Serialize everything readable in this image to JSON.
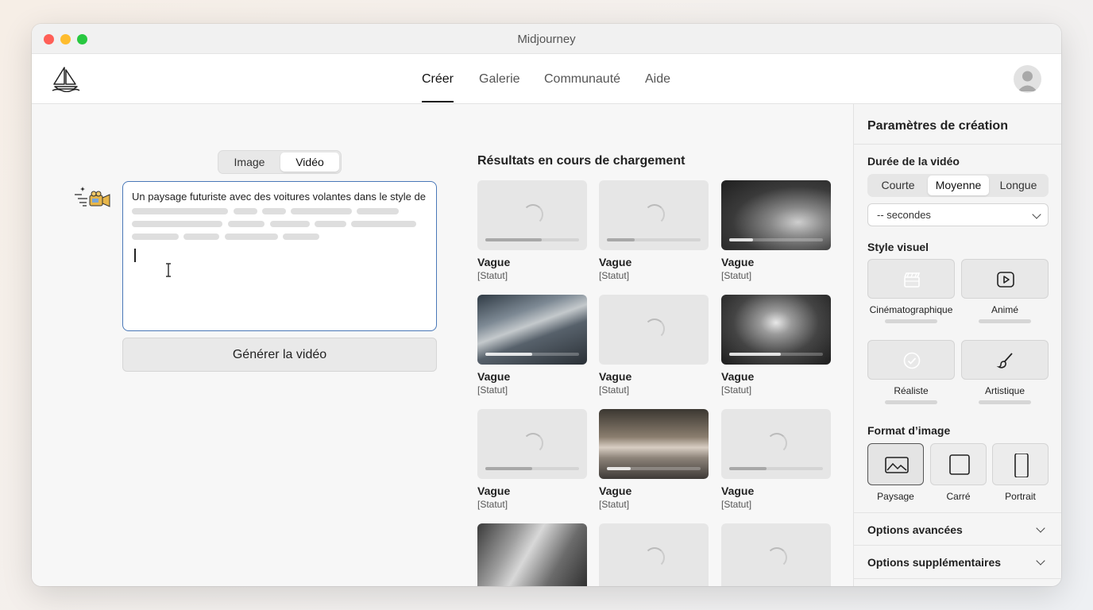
{
  "window": {
    "title": "Midjourney"
  },
  "nav": {
    "tabs": [
      {
        "label": "Créer",
        "active": true
      },
      {
        "label": "Galerie",
        "active": false
      },
      {
        "label": "Communauté",
        "active": false
      },
      {
        "label": "Aide",
        "active": false
      }
    ],
    "logo_icon": "sailboat-logo-icon",
    "avatar_icon": "user-avatar-icon"
  },
  "composer": {
    "mode_toggle": [
      {
        "label": "Image",
        "active": false
      },
      {
        "label": "Vidéo",
        "active": true
      }
    ],
    "prompt_icon": "video-camera-sparkle-icon",
    "prompt_text": "Un paysage futuriste avec des voitures volantes dans le style de",
    "generate_label": "Générer la vidéo"
  },
  "results": {
    "title": "Résultats en cours de chargement",
    "items": [
      {
        "name": "Vague",
        "status": "[Statut]",
        "state": "loading",
        "progress": 0.6
      },
      {
        "name": "Vague",
        "status": "[Statut]",
        "state": "loading",
        "progress": 0.3
      },
      {
        "name": "Vague",
        "status": "[Statut]",
        "state": "preview",
        "progress": 0.25
      },
      {
        "name": "Vague",
        "status": "[Statut]",
        "state": "preview",
        "progress": 0.5
      },
      {
        "name": "Vague",
        "status": "[Statut]",
        "state": "loading",
        "progress": 0
      },
      {
        "name": "Vague",
        "status": "[Statut]",
        "state": "preview",
        "progress": 0.55
      },
      {
        "name": "Vague",
        "status": "[Statut]",
        "state": "loading",
        "progress": 0.5
      },
      {
        "name": "Vague",
        "status": "[Statut]",
        "state": "preview",
        "progress": 0.25
      },
      {
        "name": "Vague",
        "status": "[Statut]",
        "state": "loading",
        "progress": 0.4
      },
      {
        "name": "",
        "status": "",
        "state": "preview",
        "progress": 0
      },
      {
        "name": "",
        "status": "",
        "state": "loading",
        "progress": 0
      },
      {
        "name": "",
        "status": "",
        "state": "loading",
        "progress": 0
      }
    ]
  },
  "settings": {
    "title": "Paramètres de création",
    "duration": {
      "label": "Durée de la vidéo",
      "options": [
        {
          "label": "Courte",
          "active": false
        },
        {
          "label": "Moyenne",
          "active": true
        },
        {
          "label": "Longue",
          "active": false
        }
      ],
      "seconds_select": "-- secondes"
    },
    "style": {
      "label": "Style visuel",
      "options": [
        {
          "label": "Cinématographique",
          "icon": "clapperboard-icon"
        },
        {
          "label": "Animé",
          "icon": "play-icon"
        },
        {
          "label": "Réaliste",
          "icon": "checkmark-circle-icon"
        },
        {
          "label": "Artistique",
          "icon": "paintbrush-icon"
        }
      ]
    },
    "format": {
      "label": "Format d’image",
      "options": [
        {
          "label": "Paysage",
          "icon": "landscape-image-icon",
          "selected": true
        },
        {
          "label": "Carré",
          "icon": "square-icon",
          "selected": false
        },
        {
          "label": "Portrait",
          "icon": "portrait-icon",
          "selected": false
        }
      ]
    },
    "advanced": "Options avancées",
    "extra": "Options supplémentaires"
  }
}
